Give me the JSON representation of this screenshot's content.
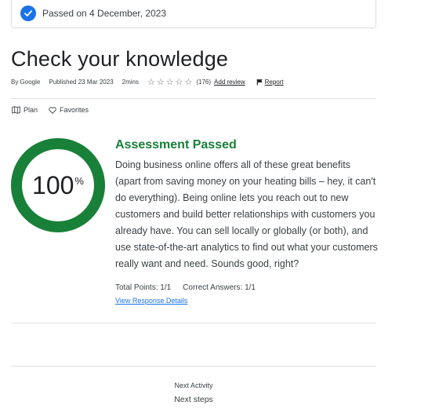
{
  "banner": {
    "text": "Passed on 4 December, 2023"
  },
  "title": "Check your knowledge",
  "meta": {
    "author": "By Google",
    "published": "Published 23 Mar 2023",
    "duration": "2mins",
    "rating_count": "(176)",
    "add_review": "Add review",
    "report": "Report"
  },
  "actions": {
    "plan": "Plan",
    "favorites": "Favorites"
  },
  "score": {
    "value": "100",
    "unit": "%",
    "fraction": 1.0,
    "color": "#188038"
  },
  "result": {
    "title": "Assessment Passed",
    "description": "Doing business online offers all of these great benefits (apart from saving money on your heating bills – hey, it can't do everything). Being online lets you reach out to new customers and build better relationships with customers you already have. You can sell locally or globally (or both), and use state-of-the-art analytics to find out what your customers really want and need. Sounds good, right?"
  },
  "stats": {
    "total_points": "Total Points: 1/1",
    "correct_answers": "Correct Answers: 1/1"
  },
  "response_link": "View Response Details",
  "next": {
    "label": "Next Activity",
    "title": "Next steps"
  }
}
